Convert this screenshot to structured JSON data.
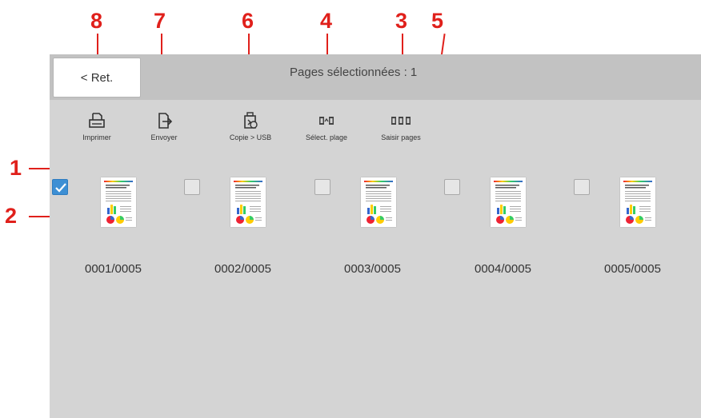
{
  "callouts": [
    "1",
    "2",
    "3",
    "4",
    "5",
    "6",
    "7",
    "8"
  ],
  "header": {
    "back_label": "< Ret.",
    "selected_text": "Pages sélectionnées : 1"
  },
  "toolbar": {
    "print": "Imprimer",
    "send": "Envoyer",
    "copy_usb": "Copie > USB",
    "select_range": "Sélect. plage",
    "enter_pages": "Saisir pages"
  },
  "pages": [
    {
      "label": "0001/0005",
      "checked": true
    },
    {
      "label": "0002/0005",
      "checked": false
    },
    {
      "label": "0003/0005",
      "checked": false
    },
    {
      "label": "0004/0005",
      "checked": false
    },
    {
      "label": "0005/0005",
      "checked": false
    }
  ],
  "colors": {
    "callout": "#e0201b",
    "checkbox_checked": "#3d8fd4",
    "panel_bg": "#d4d4d4",
    "header_bg": "#c2c2c2"
  },
  "icons": [
    "print-icon",
    "send-icon",
    "copy-usb-icon",
    "select-range-icon",
    "enter-pages-icon",
    "check-icon"
  ]
}
